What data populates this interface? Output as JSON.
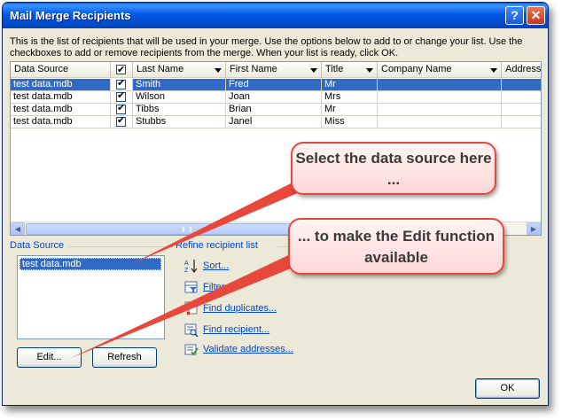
{
  "window": {
    "title": "Mail Merge Recipients",
    "help_label": "?",
    "close_label": "✕",
    "intro_text": "This is the list of recipients that will be used in your merge.  Use the options below to add to or change your list.  Use the checkboxes to add or remove recipients from the merge.  When your list is ready, click OK."
  },
  "grid": {
    "columns": [
      "Data Source",
      "Last Name",
      "First Name",
      "Title",
      "Company Name",
      "Address"
    ],
    "rows": [
      {
        "source": "test data.mdb",
        "last": "Smith",
        "first": "Fred",
        "title": "Mr",
        "checked": true,
        "selected": true
      },
      {
        "source": "test data.mdb",
        "last": "Wilson",
        "first": "Joan",
        "title": "Mrs",
        "checked": true,
        "selected": false
      },
      {
        "source": "test data.mdb",
        "last": "Tibbs",
        "first": "Brian",
        "title": "Mr",
        "checked": true,
        "selected": false
      },
      {
        "source": "test data.mdb",
        "last": "Stubbs",
        "first": "Janel",
        "title": "Miss",
        "checked": true,
        "selected": false
      }
    ]
  },
  "data_source": {
    "label": "Data Source",
    "items": [
      "test data.mdb"
    ],
    "edit_label": "Edit...",
    "refresh_label": "Refresh"
  },
  "refine": {
    "label": "Refine recipient list",
    "items": [
      {
        "label": "Sort...",
        "icon": "sort-icon"
      },
      {
        "label": "Filter...",
        "icon": "filter-icon"
      },
      {
        "label": "Find duplicates...",
        "icon": "find-duplicates-icon"
      },
      {
        "label": "Find recipient...",
        "icon": "find-recipient-icon"
      },
      {
        "label": "Validate addresses...",
        "icon": "validate-addresses-icon"
      }
    ]
  },
  "ok_label": "OK",
  "callouts": {
    "top": "Select the data source here ...",
    "bottom": "... to make the Edit function available"
  },
  "colors": {
    "selection": "#316ac5",
    "callout_border": "#e8483c",
    "link": "#0046d5"
  }
}
